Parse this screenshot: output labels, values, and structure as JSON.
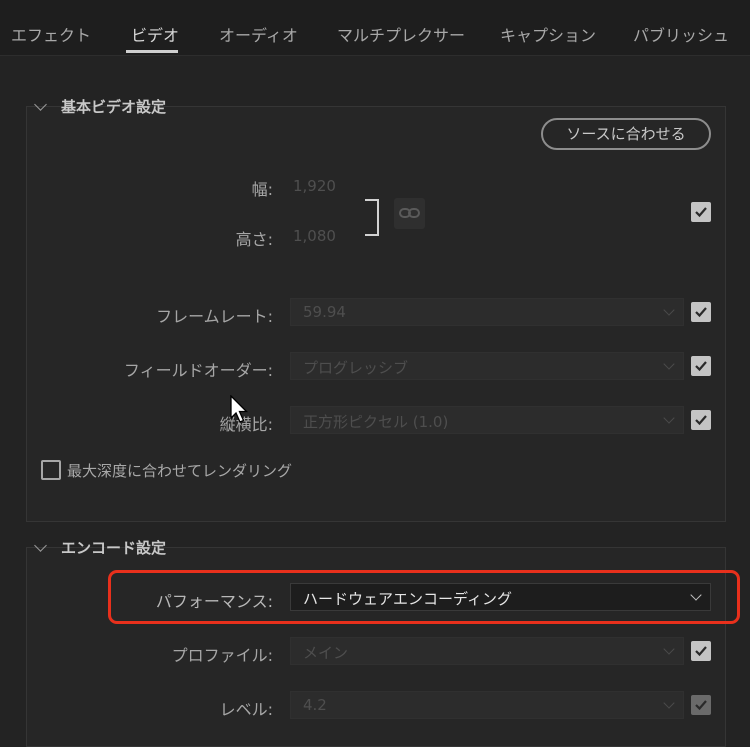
{
  "tabs": [
    {
      "label": "エフェクト",
      "active": false
    },
    {
      "label": "ビデオ",
      "active": true
    },
    {
      "label": "オーディオ",
      "active": false
    },
    {
      "label": "マルチプレクサー",
      "active": false
    },
    {
      "label": "キャプション",
      "active": false
    },
    {
      "label": "パブリッシュ",
      "active": false
    }
  ],
  "basic_video": {
    "title": "基本ビデオ設定",
    "match_source_label": "ソースに合わせる",
    "width_label": "幅:",
    "width_value": "1,920",
    "height_label": "高さ:",
    "height_value": "1,080",
    "link_icon": "link-icon",
    "frame_rate_label": "フレームレート:",
    "frame_rate_value": "59.94",
    "field_order_label": "フィールドオーダー:",
    "field_order_value": "プログレッシブ",
    "aspect_label": "縦横比:",
    "aspect_value": "正方形ピクセル (1.0)",
    "max_depth_label": "最大深度に合わせてレンダリング",
    "max_depth_checked": false
  },
  "encode": {
    "title": "エンコード設定",
    "performance_label": "パフォーマンス:",
    "performance_value": "ハードウェアエンコーディング",
    "profile_label": "プロファイル:",
    "profile_value": "メイン",
    "level_label": "レベル:",
    "level_value": "4.2"
  },
  "colors": {
    "background": "#232323",
    "highlight": "#e8301c",
    "checkbox": "#c4c4c4"
  }
}
